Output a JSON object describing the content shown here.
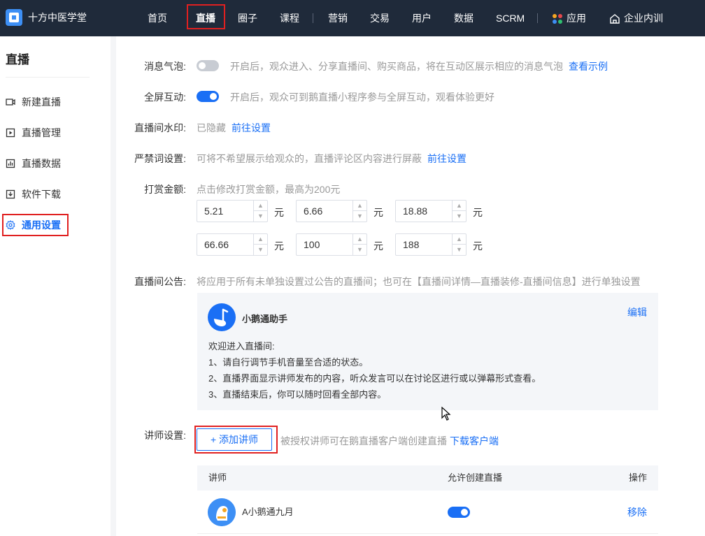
{
  "brand": {
    "name": "十方中医学堂"
  },
  "nav": {
    "items": [
      "首页",
      "直播",
      "圈子",
      "课程",
      "营销",
      "交易",
      "用户",
      "数据",
      "SCRM"
    ],
    "apps": "应用",
    "training": "企业内训"
  },
  "sidebar": {
    "title": "直播",
    "items": [
      "新建直播",
      "直播管理",
      "直播数据",
      "软件下载",
      "通用设置"
    ]
  },
  "settings": {
    "bubble": {
      "label": "消息气泡:",
      "desc": "开启后，观众进入、分享直播间、购买商品，将在互动区展示相应的消息气泡",
      "link": "查看示例",
      "enabled": false
    },
    "fullscreen": {
      "label": "全屏互动:",
      "desc": "开启后，观众可到鹅直播小程序参与全屏互动，观看体验更好",
      "enabled": true
    },
    "watermark": {
      "label": "直播间水印:",
      "value": "已隐藏",
      "link": "前往设置"
    },
    "banned": {
      "label": "严禁词设置:",
      "desc": "可将不希望展示给观众的，直播评论区内容进行屏蔽",
      "link": "前往设置"
    },
    "reward": {
      "label": "打赏金额:",
      "desc": "点击修改打赏金额，最高为200元",
      "amounts": [
        "5.21",
        "6.66",
        "18.88",
        "66.66",
        "100",
        "188"
      ],
      "unit": "元"
    },
    "notice": {
      "label": "直播间公告:",
      "desc": "将应用于所有未单独设置过公告的直播间；也可在【直播间详情—直播装修-直播间信息】进行单独设置",
      "card": {
        "name": "小鹅通助手",
        "edit": "编辑",
        "lines": [
          "欢迎进入直播间:",
          "1、请自行调节手机音量至合适的状态。",
          "2、直播界面显示讲师发布的内容，听众发言可以在讨论区进行或以弹幕形式查看。",
          "3、直播结束后，你可以随时回看全部内容。"
        ]
      }
    },
    "teacher": {
      "label": "讲师设置:",
      "add_button": "+ 添加讲师",
      "desc": "被授权讲师可在鹅直播客户端创建直播",
      "link": "下载客户端",
      "table": {
        "headers": [
          "讲师",
          "允许创建直播",
          "操作"
        ],
        "rows": [
          {
            "name": "A小鹅通九月",
            "allow": true,
            "action": "移除"
          }
        ]
      }
    }
  },
  "colors": {
    "accent": "#1a6ff5",
    "nav_bg": "#1f2a3a",
    "highlight": "#e02020"
  }
}
